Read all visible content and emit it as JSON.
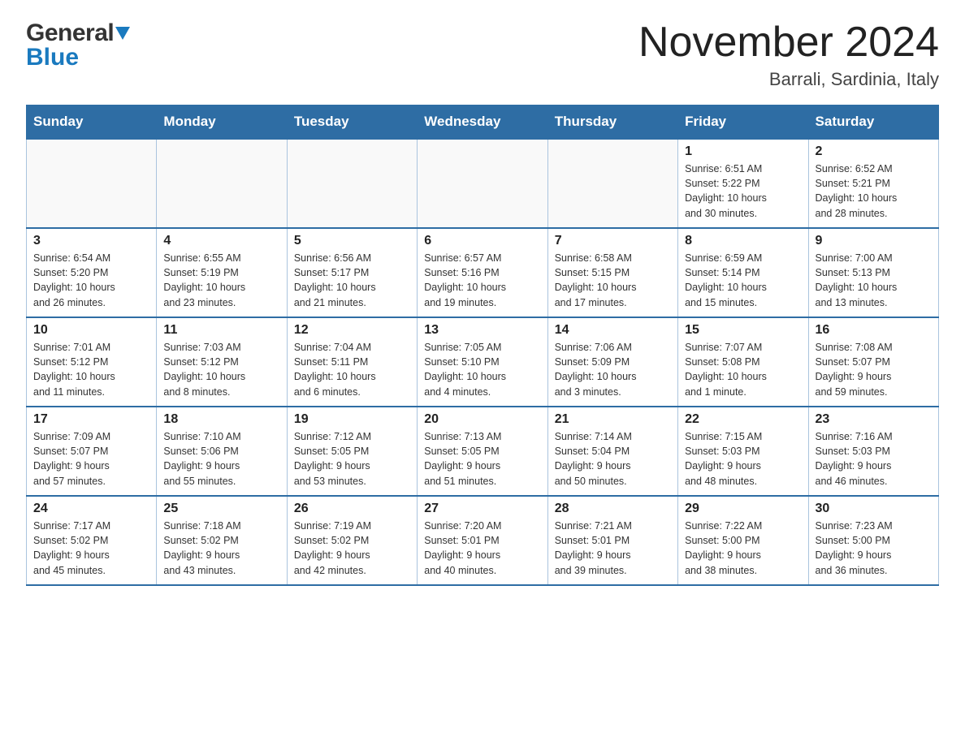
{
  "header": {
    "logo_line1": "General",
    "logo_line2": "Blue",
    "month_title": "November 2024",
    "location": "Barrali, Sardinia, Italy"
  },
  "weekdays": [
    "Sunday",
    "Monday",
    "Tuesday",
    "Wednesday",
    "Thursday",
    "Friday",
    "Saturday"
  ],
  "weeks": [
    [
      {
        "day": "",
        "info": ""
      },
      {
        "day": "",
        "info": ""
      },
      {
        "day": "",
        "info": ""
      },
      {
        "day": "",
        "info": ""
      },
      {
        "day": "",
        "info": ""
      },
      {
        "day": "1",
        "info": "Sunrise: 6:51 AM\nSunset: 5:22 PM\nDaylight: 10 hours\nand 30 minutes."
      },
      {
        "day": "2",
        "info": "Sunrise: 6:52 AM\nSunset: 5:21 PM\nDaylight: 10 hours\nand 28 minutes."
      }
    ],
    [
      {
        "day": "3",
        "info": "Sunrise: 6:54 AM\nSunset: 5:20 PM\nDaylight: 10 hours\nand 26 minutes."
      },
      {
        "day": "4",
        "info": "Sunrise: 6:55 AM\nSunset: 5:19 PM\nDaylight: 10 hours\nand 23 minutes."
      },
      {
        "day": "5",
        "info": "Sunrise: 6:56 AM\nSunset: 5:17 PM\nDaylight: 10 hours\nand 21 minutes."
      },
      {
        "day": "6",
        "info": "Sunrise: 6:57 AM\nSunset: 5:16 PM\nDaylight: 10 hours\nand 19 minutes."
      },
      {
        "day": "7",
        "info": "Sunrise: 6:58 AM\nSunset: 5:15 PM\nDaylight: 10 hours\nand 17 minutes."
      },
      {
        "day": "8",
        "info": "Sunrise: 6:59 AM\nSunset: 5:14 PM\nDaylight: 10 hours\nand 15 minutes."
      },
      {
        "day": "9",
        "info": "Sunrise: 7:00 AM\nSunset: 5:13 PM\nDaylight: 10 hours\nand 13 minutes."
      }
    ],
    [
      {
        "day": "10",
        "info": "Sunrise: 7:01 AM\nSunset: 5:12 PM\nDaylight: 10 hours\nand 11 minutes."
      },
      {
        "day": "11",
        "info": "Sunrise: 7:03 AM\nSunset: 5:12 PM\nDaylight: 10 hours\nand 8 minutes."
      },
      {
        "day": "12",
        "info": "Sunrise: 7:04 AM\nSunset: 5:11 PM\nDaylight: 10 hours\nand 6 minutes."
      },
      {
        "day": "13",
        "info": "Sunrise: 7:05 AM\nSunset: 5:10 PM\nDaylight: 10 hours\nand 4 minutes."
      },
      {
        "day": "14",
        "info": "Sunrise: 7:06 AM\nSunset: 5:09 PM\nDaylight: 10 hours\nand 3 minutes."
      },
      {
        "day": "15",
        "info": "Sunrise: 7:07 AM\nSunset: 5:08 PM\nDaylight: 10 hours\nand 1 minute."
      },
      {
        "day": "16",
        "info": "Sunrise: 7:08 AM\nSunset: 5:07 PM\nDaylight: 9 hours\nand 59 minutes."
      }
    ],
    [
      {
        "day": "17",
        "info": "Sunrise: 7:09 AM\nSunset: 5:07 PM\nDaylight: 9 hours\nand 57 minutes."
      },
      {
        "day": "18",
        "info": "Sunrise: 7:10 AM\nSunset: 5:06 PM\nDaylight: 9 hours\nand 55 minutes."
      },
      {
        "day": "19",
        "info": "Sunrise: 7:12 AM\nSunset: 5:05 PM\nDaylight: 9 hours\nand 53 minutes."
      },
      {
        "day": "20",
        "info": "Sunrise: 7:13 AM\nSunset: 5:05 PM\nDaylight: 9 hours\nand 51 minutes."
      },
      {
        "day": "21",
        "info": "Sunrise: 7:14 AM\nSunset: 5:04 PM\nDaylight: 9 hours\nand 50 minutes."
      },
      {
        "day": "22",
        "info": "Sunrise: 7:15 AM\nSunset: 5:03 PM\nDaylight: 9 hours\nand 48 minutes."
      },
      {
        "day": "23",
        "info": "Sunrise: 7:16 AM\nSunset: 5:03 PM\nDaylight: 9 hours\nand 46 minutes."
      }
    ],
    [
      {
        "day": "24",
        "info": "Sunrise: 7:17 AM\nSunset: 5:02 PM\nDaylight: 9 hours\nand 45 minutes."
      },
      {
        "day": "25",
        "info": "Sunrise: 7:18 AM\nSunset: 5:02 PM\nDaylight: 9 hours\nand 43 minutes."
      },
      {
        "day": "26",
        "info": "Sunrise: 7:19 AM\nSunset: 5:02 PM\nDaylight: 9 hours\nand 42 minutes."
      },
      {
        "day": "27",
        "info": "Sunrise: 7:20 AM\nSunset: 5:01 PM\nDaylight: 9 hours\nand 40 minutes."
      },
      {
        "day": "28",
        "info": "Sunrise: 7:21 AM\nSunset: 5:01 PM\nDaylight: 9 hours\nand 39 minutes."
      },
      {
        "day": "29",
        "info": "Sunrise: 7:22 AM\nSunset: 5:00 PM\nDaylight: 9 hours\nand 38 minutes."
      },
      {
        "day": "30",
        "info": "Sunrise: 7:23 AM\nSunset: 5:00 PM\nDaylight: 9 hours\nand 36 minutes."
      }
    ]
  ]
}
